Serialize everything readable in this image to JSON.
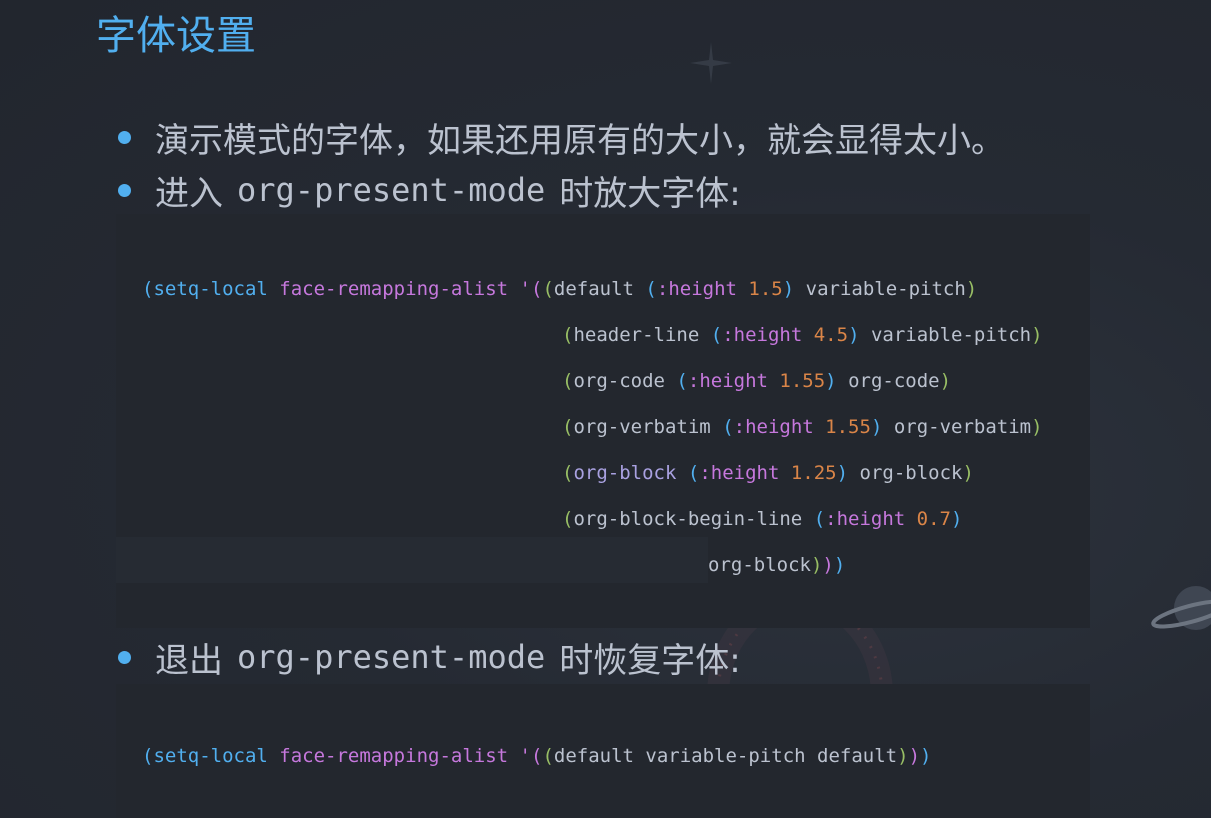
{
  "slide": {
    "title": "字体设置",
    "bullets": [
      {
        "text": "演示模式的字体，如果还用原有的大小，就会显得太小。"
      },
      {
        "pre": "进入",
        "code": "org-present-mode",
        "post": "时放大字体:"
      },
      {
        "pre": "退出",
        "code": "org-present-mode",
        "post": "时恢复字体:"
      }
    ]
  },
  "code_block_1": {
    "setq": "setq-local",
    "fn": "face-remapping-alist",
    "quote": "'",
    "kw": ":height",
    "entries": [
      {
        "face": "default",
        "height": "1.5",
        "inherit": "variable-pitch"
      },
      {
        "face": "header-line",
        "height": "4.5",
        "inherit": "variable-pitch"
      },
      {
        "face": "org-code",
        "height": "1.55",
        "inherit": "org-code"
      },
      {
        "face": "org-verbatim",
        "height": "1.55",
        "inherit": "org-verbatim"
      },
      {
        "face": "org-block",
        "height": "1.25",
        "inherit": "org-block"
      },
      {
        "face": "org-block-begin-line",
        "height": "0.7",
        "inherit": "org-block"
      }
    ]
  },
  "code_block_2": {
    "setq": "setq-local",
    "fn": "face-remapping-alist",
    "quote": "'",
    "face": "default",
    "inherit1": "variable-pitch",
    "inherit2": "default"
  },
  "colors": {
    "title": "#51afef",
    "bullet_dot": "#51afef",
    "keyword": "#c678dd",
    "number": "#da8548",
    "background": "#252a33",
    "code_background": "#23272e"
  },
  "icons": [
    "star-icon",
    "galaxy-ring-icon",
    "planet-icon",
    "rocket-icon"
  ]
}
